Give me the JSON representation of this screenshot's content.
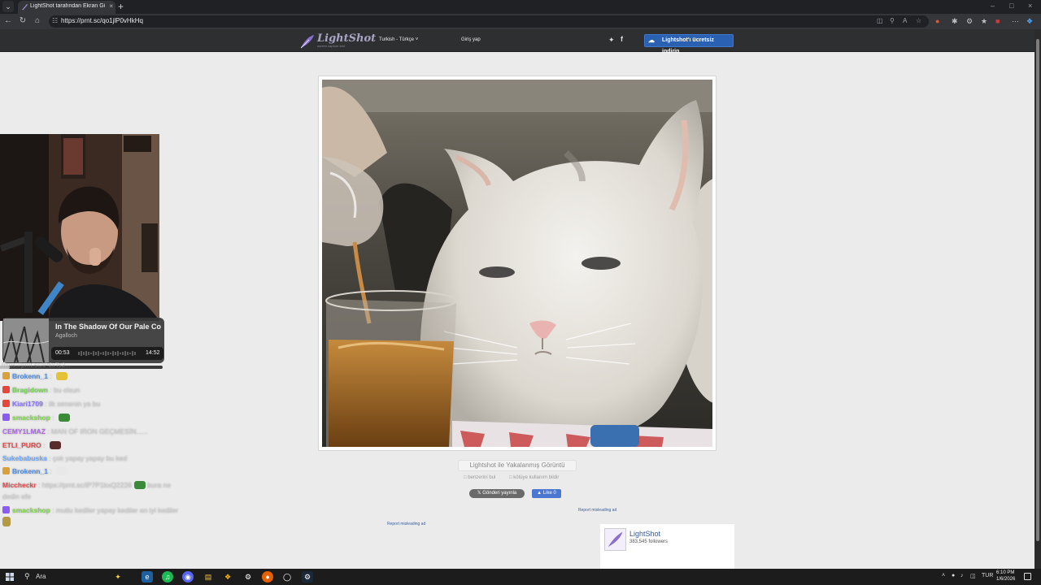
{
  "browser": {
    "tab_title": "LightShot tarafından Ekran Görün",
    "url": "https://prnt.sc/qo1jlP0vHkHq"
  },
  "site": {
    "logo": "LightShot",
    "logo_subtitle": "screen capture tool",
    "language": "Turkish - Türkçe",
    "login": "Giriş yap",
    "download_button": "Lightshot'ı ücretsiz indirin",
    "caption": "Lightshot ile Yakalanmış Görüntü",
    "find_similar": "benzerini bul",
    "report_abuse": "kötüye kullanım bildir",
    "tweet_button": "Gönderi yayınla",
    "like_button": "Like 0",
    "report_ad_right": "Report misleading ad",
    "report_ad_left": "Report misleading ad",
    "fb_widget": {
      "name": "LightShot",
      "followers": "383,545 followers"
    }
  },
  "stream": {
    "music": {
      "title": "In The Shadow Of Our Pale Co",
      "artist": "Agalloch",
      "elapsed": "00:53",
      "duration": "14:52",
      "progress": 0.06
    },
    "chat_clip": "https://prnt.sc/lP6xTs2...",
    "chat": [
      {
        "user": "Brokenn_1",
        "message": "",
        "user_color": "#4f8fe5",
        "badge_color": "#d9a03c",
        "emote_color": "#e3c238"
      },
      {
        "user": "Bragidown",
        "message": "bu olsun",
        "user_color": "#6fd64c",
        "badge_color": "#e6473a",
        "emote_color": ""
      },
      {
        "user": "Kiari1709",
        "message": "ilk senenin ya bu",
        "user_color": "#8a72ff",
        "badge_color": "#e6473a",
        "emote_color": ""
      },
      {
        "user": "smackshop",
        "message": "",
        "user_color": "#7fd64a",
        "badge_color": "#8a5cf5",
        "emote_color": "#3a8a3a"
      },
      {
        "user": "CEMY1LMAZ",
        "message": "MAN OF IRON GEÇMESİN......",
        "user_color": "#b06ae8",
        "badge_color": "",
        "emote_color": ""
      },
      {
        "user": "ETLI_PURO",
        "message": "",
        "user_color": "#e54848",
        "badge_color": "",
        "emote_color": "#5a2d2d"
      },
      {
        "user": "Sukebabuska",
        "message": "çok yapay yapay bu ked",
        "user_color": "#6ea8ff",
        "badge_color": "",
        "emote_color": ""
      },
      {
        "user": "Brokenn_1",
        "message": "",
        "user_color": "#4f8fe5",
        "badge_color": "#d9a03c",
        "emote_color": "#e8e8e8"
      },
      {
        "user": "Miccheckr",
        "message": "https://prnt.sc/lP7P1kxQ2226",
        "message2": "bura ne",
        "message3": "dedin efe",
        "user_color": "#e44a4a",
        "badge_color": "",
        "emote_color": "#3a8a3a"
      },
      {
        "user": "smackshop",
        "message": "mutlu kediler yapay kediler en iyi kediler",
        "user_color": "#7fd64a",
        "badge_color": "#8a5cf5",
        "emote_color": "#b59a45"
      }
    ]
  },
  "taskbar": {
    "search_label": "Ara",
    "language": "TUR",
    "time": "6:10 PM",
    "date": "1/6/2026"
  },
  "colors": {
    "header_bg": "#2e2f31",
    "download_button": "#2a61b2",
    "page_bg": "#ebebeb"
  }
}
